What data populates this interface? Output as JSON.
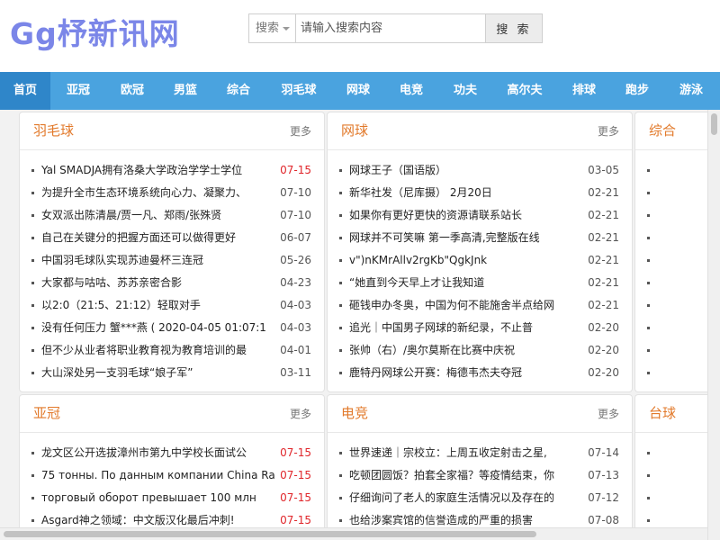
{
  "header": {
    "logo": "Gg杼新讯网",
    "search": {
      "category": "搜索",
      "placeholder": "请输入搜索内容",
      "button": "搜 索"
    }
  },
  "nav": {
    "items": [
      {
        "label": "首页",
        "active": true
      },
      {
        "label": "亚冠"
      },
      {
        "label": "欧冠"
      },
      {
        "label": "男篮"
      },
      {
        "label": "综合"
      },
      {
        "label": "羽毛球"
      },
      {
        "label": "网球"
      },
      {
        "label": "电竞"
      },
      {
        "label": "功夫"
      },
      {
        "label": "高尔夫"
      },
      {
        "label": "排球"
      },
      {
        "label": "跑步"
      },
      {
        "label": "游泳"
      }
    ]
  },
  "accent_color": "#e2792a",
  "nav_color": "#4aa3df",
  "panels": [
    {
      "title": "羽毛球",
      "more": "更多",
      "items": [
        {
          "text": "Yal SMADJA拥有洛桑大学政治学学士学位",
          "date": "07-15",
          "highlight": true
        },
        {
          "text": "为提升全市生态环境系统向心力、凝聚力、",
          "date": "07-10"
        },
        {
          "text": "女双派出陈清晨/贾一凡、郑雨/张殊贤",
          "date": "07-10"
        },
        {
          "text": "自己在关键分的把握方面还可以做得更好",
          "date": "06-07"
        },
        {
          "text": "中国羽毛球队实现苏迪曼杯三连冠",
          "date": "05-26"
        },
        {
          "text": "大家都与咕咕、苏苏亲密合影",
          "date": "04-23"
        },
        {
          "text": "以2:0（21:5、21:12）轻取对手",
          "date": "04-03"
        },
        {
          "text": "没有任何压力 蟹***燕 ( 2020-04-05 01:07:1",
          "date": "04-03"
        },
        {
          "text": "但不少从业者将职业教育视为教育培训的最",
          "date": "04-01"
        },
        {
          "text": "大山深处另一支羽毛球“娘子军”",
          "date": "03-11"
        }
      ]
    },
    {
      "title": "网球",
      "more": "更多",
      "items": [
        {
          "text": "网球王子（国语版）",
          "date": "03-05"
        },
        {
          "text": "新华社发（尼库摄） 2月20日",
          "date": "02-21"
        },
        {
          "text": "如果你有更好更快的资源请联系站长",
          "date": "02-21"
        },
        {
          "text": "网球并不可笑嘛 第一季高清,完整版在线",
          "date": "02-21"
        },
        {
          "text": "v\")nKMrAllv2rgKb\"QgkJnk",
          "date": "02-21"
        },
        {
          "text": "“她直到今天早上才让我知道",
          "date": "02-21"
        },
        {
          "text": "砸钱申办冬奥，中国为何不能施舍半点给网",
          "date": "02-21"
        },
        {
          "text": "追光｜中国男子网球的新纪录，不止普",
          "date": "02-20"
        },
        {
          "text": "张帅（右）/奥尔莫斯在比赛中庆祝",
          "date": "02-20"
        },
        {
          "text": "鹿特丹网球公开赛：梅德韦杰夫夺冠",
          "date": "02-20"
        }
      ]
    },
    {
      "title": "综合",
      "more": "",
      "items": [
        {
          "text": "",
          "date": ""
        },
        {
          "text": "",
          "date": ""
        },
        {
          "text": "",
          "date": ""
        },
        {
          "text": "",
          "date": ""
        },
        {
          "text": "",
          "date": ""
        },
        {
          "text": "",
          "date": ""
        },
        {
          "text": "",
          "date": ""
        },
        {
          "text": "",
          "date": ""
        },
        {
          "text": "",
          "date": ""
        },
        {
          "text": "",
          "date": ""
        }
      ]
    },
    {
      "title": "亚冠",
      "more": "更多",
      "items": [
        {
          "text": "龙文区公开选拔漳州市第九中学校长面试公",
          "date": "07-15",
          "highlight": true
        },
        {
          "text": "75 тонны. По данным компании China Ra",
          "date": "07-15",
          "highlight": true
        },
        {
          "text": "торговый оборот превышает 100 млн",
          "date": "07-15",
          "highlight": true
        },
        {
          "text": "Asgard神之领域：中文版汉化最后冲刺!",
          "date": "07-15",
          "highlight": true
        }
      ]
    },
    {
      "title": "电竞",
      "more": "更多",
      "items": [
        {
          "text": "世界速递｜宗校立：上周五收定射击之星,",
          "date": "07-14"
        },
        {
          "text": "吃顿团圆饭？拍套全家福？等疫情结束，你",
          "date": "07-13"
        },
        {
          "text": "仔细询问了老人的家庭生活情况以及存在的",
          "date": "07-12"
        },
        {
          "text": "也给涉案宾馆的信誉造成的严重的损害",
          "date": "07-08"
        }
      ]
    },
    {
      "title": "台球",
      "more": "",
      "items": [
        {
          "text": "",
          "date": ""
        },
        {
          "text": "",
          "date": ""
        },
        {
          "text": "",
          "date": ""
        },
        {
          "text": "",
          "date": ""
        }
      ]
    }
  ]
}
